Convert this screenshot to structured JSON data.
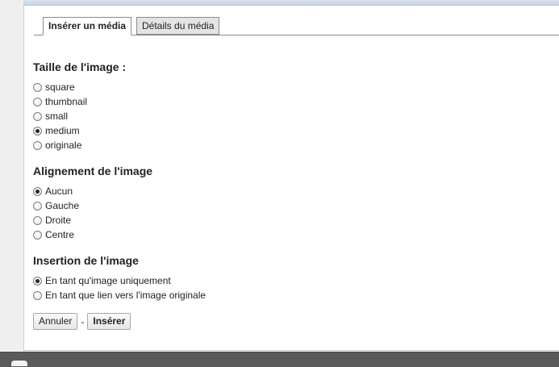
{
  "tabs": [
    {
      "label": "Insérer un média",
      "active": true
    },
    {
      "label": "Détails du média",
      "active": false
    }
  ],
  "size_section": {
    "title": "Taille de l'image :",
    "options": [
      {
        "label": "square",
        "checked": false
      },
      {
        "label": "thumbnail",
        "checked": false
      },
      {
        "label": "small",
        "checked": false
      },
      {
        "label": "medium",
        "checked": true
      },
      {
        "label": "originale",
        "checked": false
      }
    ]
  },
  "alignment_section": {
    "title": "Alignement de l'image",
    "options": [
      {
        "label": "Aucun",
        "checked": true
      },
      {
        "label": "Gauche",
        "checked": false
      },
      {
        "label": "Droite",
        "checked": false
      },
      {
        "label": "Centre",
        "checked": false
      }
    ]
  },
  "insertion_section": {
    "title": "Insertion de l'image",
    "options": [
      {
        "label": "En tant qu'image uniquement",
        "checked": true
      },
      {
        "label": "En tant que lien vers l'image originale",
        "checked": false
      }
    ]
  },
  "actions": {
    "cancel_label": "Annuler",
    "separator": "-",
    "insert_label": "Insérer"
  }
}
